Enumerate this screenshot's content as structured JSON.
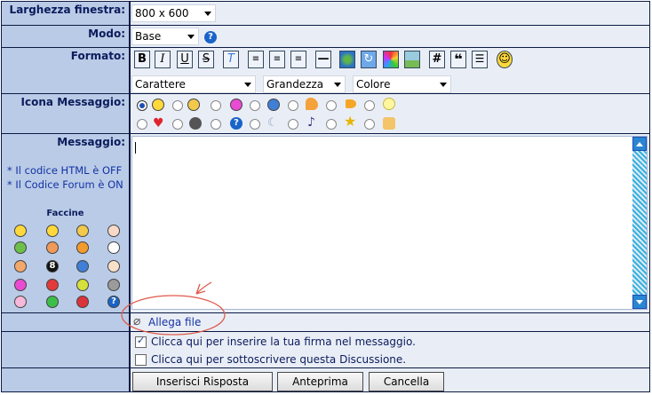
{
  "labels": {
    "window_width": "Larghezza finestra:",
    "mode": "Modo:",
    "format": "Formato:",
    "message_icon": "Icona Messaggio:",
    "message": "Messaggio:"
  },
  "window_width": {
    "selected": "800 x 600"
  },
  "mode": {
    "selected": "Base"
  },
  "format": {
    "toolbar": [
      "B",
      "I",
      "U",
      "S",
      "T",
      "align-left",
      "align-center",
      "align-right",
      "horizontal-rule",
      "globe",
      "refresh",
      "color-wheel",
      "image",
      "#",
      "quote",
      "list",
      "smiley"
    ],
    "font_select": "Carattere",
    "size_select": "Grandezza",
    "color_select": "Colore"
  },
  "notes": {
    "html": "* Il codice HTML è OFF",
    "forum": "* Il Codice Forum è ON"
  },
  "faccine_title": "Faccine",
  "attach": "Allega file",
  "options": {
    "signature": "Clicca qui per inserire la tua firma nel messaggio.",
    "subscribe": "Clicca qui per sottoscrivere questa Discussione."
  },
  "buttons": {
    "submit": "Inserisci Risposta",
    "preview": "Anteprima",
    "cancel": "Cancella"
  },
  "colors": {
    "label_bg": "#b9cbe6",
    "value_bg": "#e9eef6",
    "border": "#0b1a44",
    "annotation": "#e05a4a"
  }
}
